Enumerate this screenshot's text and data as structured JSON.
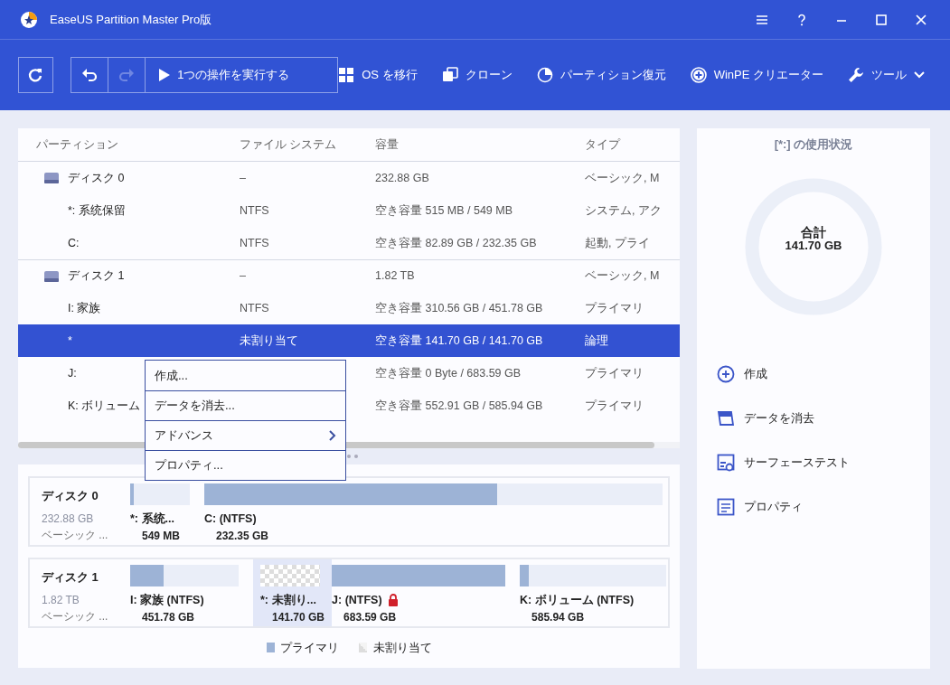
{
  "window": {
    "title": "EaseUS Partition Master Pro版"
  },
  "toolbar": {
    "undo": {
      "disabled": false
    },
    "redo": {
      "disabled": true
    },
    "execute_button": "1つの操作を実行する",
    "items": [
      {
        "label": "OS を移行",
        "dropdown": false
      },
      {
        "label": "クローン",
        "dropdown": false
      },
      {
        "label": "パーティション復元",
        "dropdown": false
      },
      {
        "label": "WinPE クリエーター",
        "dropdown": false
      },
      {
        "label": "ツール",
        "dropdown": true
      }
    ]
  },
  "table": {
    "columns": [
      "パーティション",
      "ファイル システム",
      "容量",
      "タイプ"
    ],
    "rows": [
      {
        "kind": "disk",
        "selected": false,
        "cells": [
          "ディスク 0",
          "–",
          "232.88 GB",
          "ベーシック, M"
        ]
      },
      {
        "kind": "partition",
        "selected": false,
        "cells": [
          "*: 系统保留",
          "NTFS",
          "空き容量 515 MB / 549 MB",
          "システム, アク"
        ]
      },
      {
        "kind": "partition",
        "selected": false,
        "cells": [
          "C:",
          "NTFS",
          "空き容量 82.89 GB / 232.35 GB",
          "起動, プライ"
        ]
      },
      {
        "kind": "disk",
        "selected": false,
        "cells": [
          "ディスク 1",
          "–",
          "1.82 TB",
          "ベーシック, M"
        ]
      },
      {
        "kind": "partition",
        "selected": false,
        "cells": [
          "I: 家族",
          "NTFS",
          "空き容量 310.56 GB / 451.78 GB",
          "プライマリ"
        ]
      },
      {
        "kind": "partition",
        "selected": true,
        "cells": [
          "*",
          "未割り当て",
          "空き容量 141.70 GB / 141.70 GB",
          "論理"
        ]
      },
      {
        "kind": "partition",
        "selected": false,
        "cells": [
          "J:",
          "",
          "空き容量 0 Byte / 683.59 GB",
          "プライマリ"
        ]
      },
      {
        "kind": "partition",
        "selected": false,
        "cells": [
          "K: ボリューム",
          "",
          "空き容量 552.91 GB / 585.94 GB",
          "プライマリ"
        ]
      }
    ]
  },
  "context_menu": {
    "items": [
      {
        "label": "作成...",
        "submenu": false
      },
      {
        "label": "データを消去...",
        "submenu": false
      },
      {
        "label": "アドバンス",
        "submenu": true
      },
      {
        "label": "プロパティ...",
        "submenu": false
      }
    ]
  },
  "disk_map": {
    "disks": [
      {
        "name": "ディスク 0",
        "size": "232.88 GB",
        "type": "ベーシック ...",
        "partitions": [
          {
            "kind": "primary",
            "label": "*: 系统...",
            "size": "549 MB",
            "level": 0.06,
            "selected": false,
            "locked": false
          },
          {
            "kind": "primary",
            "label": "C: (NTFS)",
            "size": "232.35 GB",
            "level": 0.64,
            "selected": false,
            "locked": false
          }
        ]
      },
      {
        "name": "ディスク 1",
        "size": "1.82 TB",
        "type": "ベーシック ...",
        "partitions": [
          {
            "kind": "primary",
            "label": "I: 家族 (NTFS)",
            "size": "451.78 GB",
            "level": 0.31,
            "selected": false,
            "locked": false
          },
          {
            "kind": "unallocated",
            "label": "*: 未割り...",
            "size": "141.70 GB",
            "selected": true,
            "locked": false
          },
          {
            "kind": "primary",
            "label": "J: (NTFS)",
            "size": "683.59 GB",
            "level": 1,
            "selected": false,
            "locked": true
          },
          {
            "kind": "primary",
            "label": "K: ボリューム (NTFS)",
            "size": "585.94 GB",
            "level": 0.06,
            "selected": false,
            "locked": false
          }
        ]
      }
    ],
    "legend": [
      {
        "kind": "primary",
        "label": "プライマリ"
      },
      {
        "kind": "unallocated",
        "label": "未割り当て"
      }
    ]
  },
  "usage_panel": {
    "title": "[*:] の使用状況",
    "total_label": "合計",
    "total_value": "141.70 GB",
    "actions": [
      {
        "label": "作成"
      },
      {
        "label": "データを消去"
      },
      {
        "label": "サーフェーステスト"
      },
      {
        "label": "プロパティ"
      }
    ]
  }
}
